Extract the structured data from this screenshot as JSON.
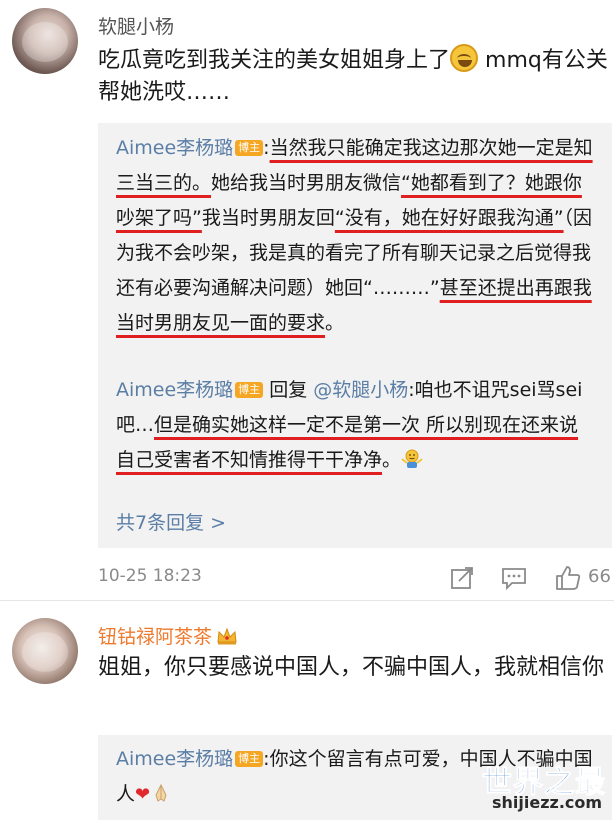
{
  "comment1": {
    "username": "软腿小杨",
    "text_a": "吃瓜竟吃到我关注的美女姐姐身上了",
    "text_b": " mmq有公关帮她洗哎……",
    "emoji": "laughing-crying-emoji"
  },
  "reply1": {
    "author": "Aimee李杨璐",
    "badge": "博主",
    "colon": ":",
    "seg1": "当然我只能确定我这边那次她一定是知三当三的。",
    "seg2": "她给我当时男朋友微信",
    "seg3": "“她都看到了？她跟你吵架了吗”",
    "seg4": "我当时男朋友回",
    "seg5": "“没有，她在好好跟我沟通”",
    "seg6": "（因为我不会吵架，我是真的看完了所有聊天记录之后觉得我还有必要沟通解决问题）她回“………”",
    "seg7": "甚至还提出再跟我当时男朋友见一面的要求",
    "seg8": "。"
  },
  "reply2": {
    "author": "Aimee李杨璐",
    "badge": "博主",
    "reply_word": " 回复 ",
    "mention": "@软腿小杨",
    "seg1": ":咱也不诅咒sei骂sei吧…",
    "seg2": "但是确实她这样一定不是第一次 所以别现在还来说自己受害者不知情推得干干净净",
    "seg3": "。",
    "emoji": "shrug-emoji"
  },
  "more_replies": "共7条回复 >",
  "meta": {
    "timestamp": "10-25 18:23",
    "like_count": "66",
    "icons": [
      "share-icon",
      "comment-icon",
      "like-icon"
    ]
  },
  "comment2": {
    "username": "钮钴禄阿茶茶",
    "icon": "crown-icon",
    "text": "姐姐，你只要感说中国人，不骗中国人，我就相信你"
  },
  "reply3": {
    "author": "Aimee李杨璐",
    "badge": "博主",
    "text": ":你这个留言有点可爱，中国人不骗中国人",
    "heart": "❤",
    "emoji": "praying-hands-emoji"
  },
  "watermark": {
    "title": "世界之最",
    "url": "shijiezz.com"
  },
  "colors": {
    "link_blue": "#5b7ea6",
    "underline_red": "#e02020",
    "username_orange": "#ee7a2e",
    "badge_orange": "#f5a623"
  }
}
